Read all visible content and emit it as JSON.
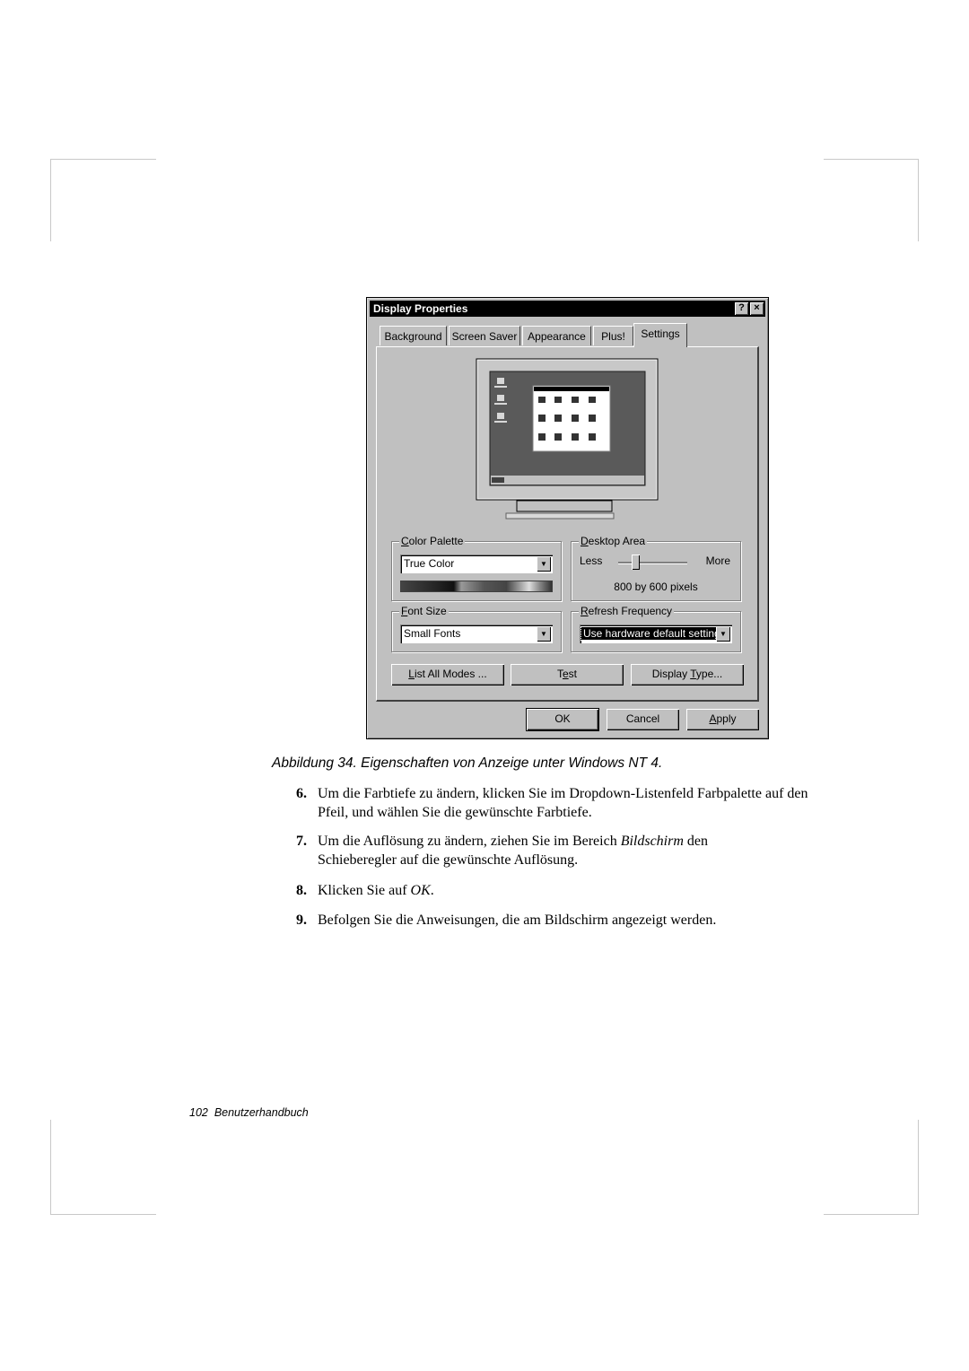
{
  "dialog": {
    "title": "Display Properties",
    "help_button": "?",
    "close_button": "×",
    "tabs": [
      {
        "label": "Background",
        "active": false
      },
      {
        "label": "Screen Saver",
        "active": false
      },
      {
        "label": "Appearance",
        "active": false
      },
      {
        "label": "Plus!",
        "active": false
      },
      {
        "label": "Settings",
        "active": true
      }
    ],
    "color_palette": {
      "label_accel": "C",
      "label_rest": "olor Palette",
      "value": "True Color"
    },
    "desktop_area": {
      "label_accel": "D",
      "label_rest": "esktop Area",
      "less_label": "Less",
      "more_label": "More",
      "slider_position_fraction": 0.25,
      "resolution_text": "800 by 600 pixels"
    },
    "font_size": {
      "label_accel": "F",
      "label_rest": "ont Size",
      "value": "Small Fonts"
    },
    "refresh_frequency": {
      "label_accel": "R",
      "label_rest": "efresh Frequency",
      "value": "Use hardware default setting"
    },
    "buttons": {
      "list_all_modes_accel": "L",
      "list_all_modes_rest": "ist All Modes ...",
      "test_pre": "T",
      "test_accel": "e",
      "test_post": "st",
      "display_type_pre": "Display ",
      "display_type_accel": "T",
      "display_type_post": "ype...",
      "ok": "OK",
      "cancel": "Cancel",
      "apply_accel": "A",
      "apply_rest": "pply"
    }
  },
  "caption": "Abbildung 34.  Eigenschaften von Anzeige unter Windows NT 4.",
  "steps": [
    {
      "num": "6.",
      "parts": [
        {
          "t": "Um die Farbtiefe zu ändern, klicken Sie im Dropdown-Listenfeld Farbpalette auf den Pfeil, und wählen Sie die gewünschte Farbtiefe.",
          "i": false
        }
      ]
    },
    {
      "num": "7.",
      "pre": "Um die Auflösung zu ändern, ziehen Sie im Bereich ",
      "em": "Bildschirm",
      "post": " den Schieberegler auf die gewünschte Auflösung."
    },
    {
      "num": "8.",
      "pre": "Klicken Sie auf ",
      "em": "OK",
      "post": "."
    },
    {
      "num": "9.",
      "pre": "Befolgen Sie die Anweisungen, die am Bildschirm angezeigt werden.",
      "em": "",
      "post": ""
    }
  ],
  "footer": {
    "page_number": "102",
    "title": "Benutzerhandbuch"
  }
}
